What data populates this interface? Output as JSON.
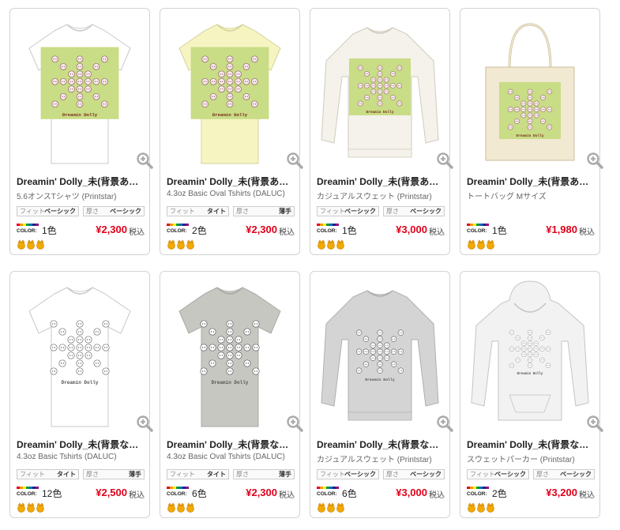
{
  "colors": {
    "price": "#e0001a",
    "border": "#d3d3d3",
    "design_bg": "#c9dc86"
  },
  "products": [
    {
      "title": "Dreamin' Dolly_未(背景あり…",
      "subtitle": "5.6オンスTシャツ (Printstar)",
      "fit_label": "フィット",
      "fit_value": "ベーシック",
      "thick_label": "厚さ",
      "thick_value": "ベーシック",
      "color_badge": "COLOR:",
      "colors": "1色",
      "price": "¥2,300",
      "tax": "税込",
      "item": "tshirt-white"
    },
    {
      "title": "Dreamin' Dolly_未(背景あり…",
      "subtitle": "4.3oz Basic Oval Tshirts (DALUC)",
      "fit_label": "フィット",
      "fit_value": "タイト",
      "thick_label": "厚さ",
      "thick_value": "薄手",
      "color_badge": "COLOR:",
      "colors": "2色",
      "price": "¥2,300",
      "tax": "税込",
      "item": "tshirt-yellow"
    },
    {
      "title": "Dreamin' Dolly_未(背景あり…",
      "subtitle": "カジュアルスウェット (Printstar)",
      "fit_label": "フィット",
      "fit_value": "ベーシック",
      "thick_label": "厚さ",
      "thick_value": "ベーシック",
      "color_badge": "COLOR:",
      "colors": "1色",
      "price": "¥3,000",
      "tax": "税込",
      "item": "sweat-cream"
    },
    {
      "title": "Dreamin' Dolly_未(背景あり…",
      "subtitle": "トートバッグ Mサイズ",
      "fit_label": "",
      "fit_value": "",
      "thick_label": "",
      "thick_value": "",
      "color_badge": "COLOR:",
      "colors": "1色",
      "price": "¥1,980",
      "tax": "税込",
      "item": "tote"
    },
    {
      "title": "Dreamin' Dolly_未(背景なし…",
      "subtitle": "4.3oz Basic Tshirts (DALUC)",
      "fit_label": "フィット",
      "fit_value": "タイト",
      "thick_label": "厚さ",
      "thick_value": "薄手",
      "color_badge": "COLOR:",
      "colors": "12色",
      "price": "¥2,500",
      "tax": "税込",
      "item": "tshirt-white2"
    },
    {
      "title": "Dreamin' Dolly_未(背景なし…",
      "subtitle": "4.3oz Basic Oval Tshirts (DALUC)",
      "fit_label": "フィット",
      "fit_value": "タイト",
      "thick_label": "厚さ",
      "thick_value": "薄手",
      "color_badge": "COLOR:",
      "colors": "6色",
      "price": "¥2,300",
      "tax": "税込",
      "item": "tshirt-gray"
    },
    {
      "title": "Dreamin' Dolly_未(背景なし…",
      "subtitle": "カジュアルスウェット (Printstar)",
      "fit_label": "フィット",
      "fit_value": "ベーシック",
      "thick_label": "厚さ",
      "thick_value": "ベーシック",
      "color_badge": "COLOR:",
      "colors": "6色",
      "price": "¥3,000",
      "tax": "税込",
      "item": "sweat-gray"
    },
    {
      "title": "Dreamin' Dolly_未(背景なし…",
      "subtitle": "スウェットパーカー (Printstar)",
      "fit_label": "フィット",
      "fit_value": "ベーシック",
      "thick_label": "厚さ",
      "thick_value": "ベーシック",
      "color_badge": "COLOR:",
      "colors": "2色",
      "price": "¥3,200",
      "tax": "税込",
      "item": "hoodie"
    }
  ],
  "design_text": "Dreamin Dolly"
}
